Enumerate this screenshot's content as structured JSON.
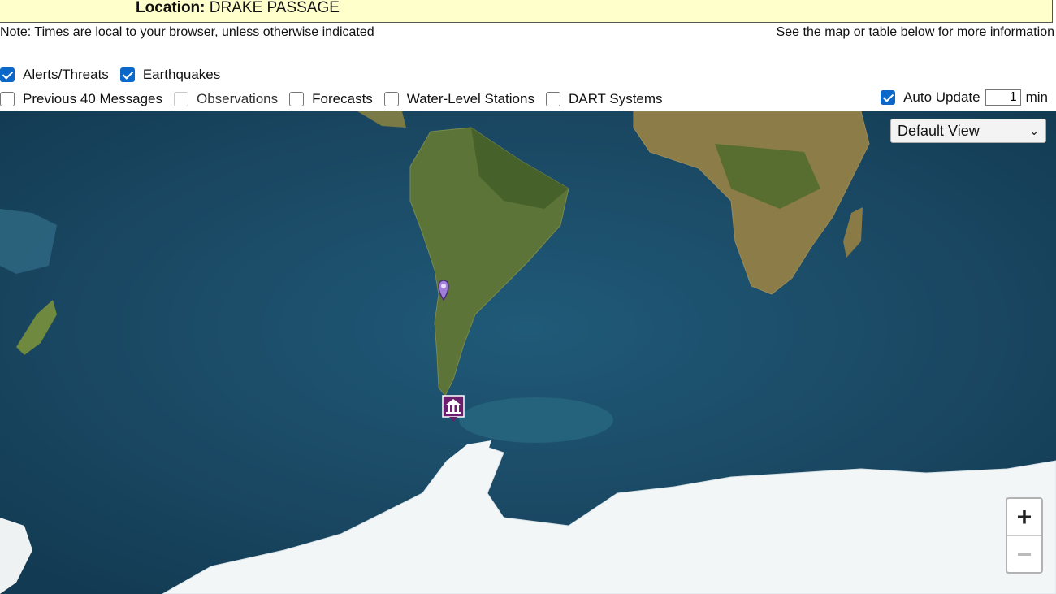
{
  "banner": {
    "location_label": "Location:",
    "location_value": "DRAKE PASSAGE"
  },
  "notes": {
    "left": "Note: Times are local to your browser, unless otherwise indicated",
    "right": "See the map or table below for more information"
  },
  "layers_row1": [
    {
      "label": "Alerts/Threats",
      "checked": true
    },
    {
      "label": "Earthquakes",
      "checked": true
    }
  ],
  "layers_row2": [
    {
      "label": "Previous 40 Messages",
      "checked": false
    },
    {
      "label": "Observations",
      "checked": false
    },
    {
      "label": "Forecasts",
      "checked": false
    },
    {
      "label": "Water-Level Stations",
      "checked": false
    },
    {
      "label": "DART Systems",
      "checked": false
    }
  ],
  "auto_update": {
    "label": "Auto Update",
    "checked": true,
    "value": "1",
    "unit": "min"
  },
  "view_select": {
    "selected": "Default View"
  },
  "zoom": {
    "plus": "+",
    "minus": "−"
  },
  "colors": {
    "checkbox_accent": "#0b68c9",
    "banner_bg": "#ffffcc",
    "ocean": "#1c4b66",
    "marker": "#6b1e6b"
  },
  "icons": [
    "check-icon",
    "chevron-down-icon",
    "map-pin-icon",
    "tsunami-warning-icon"
  ]
}
